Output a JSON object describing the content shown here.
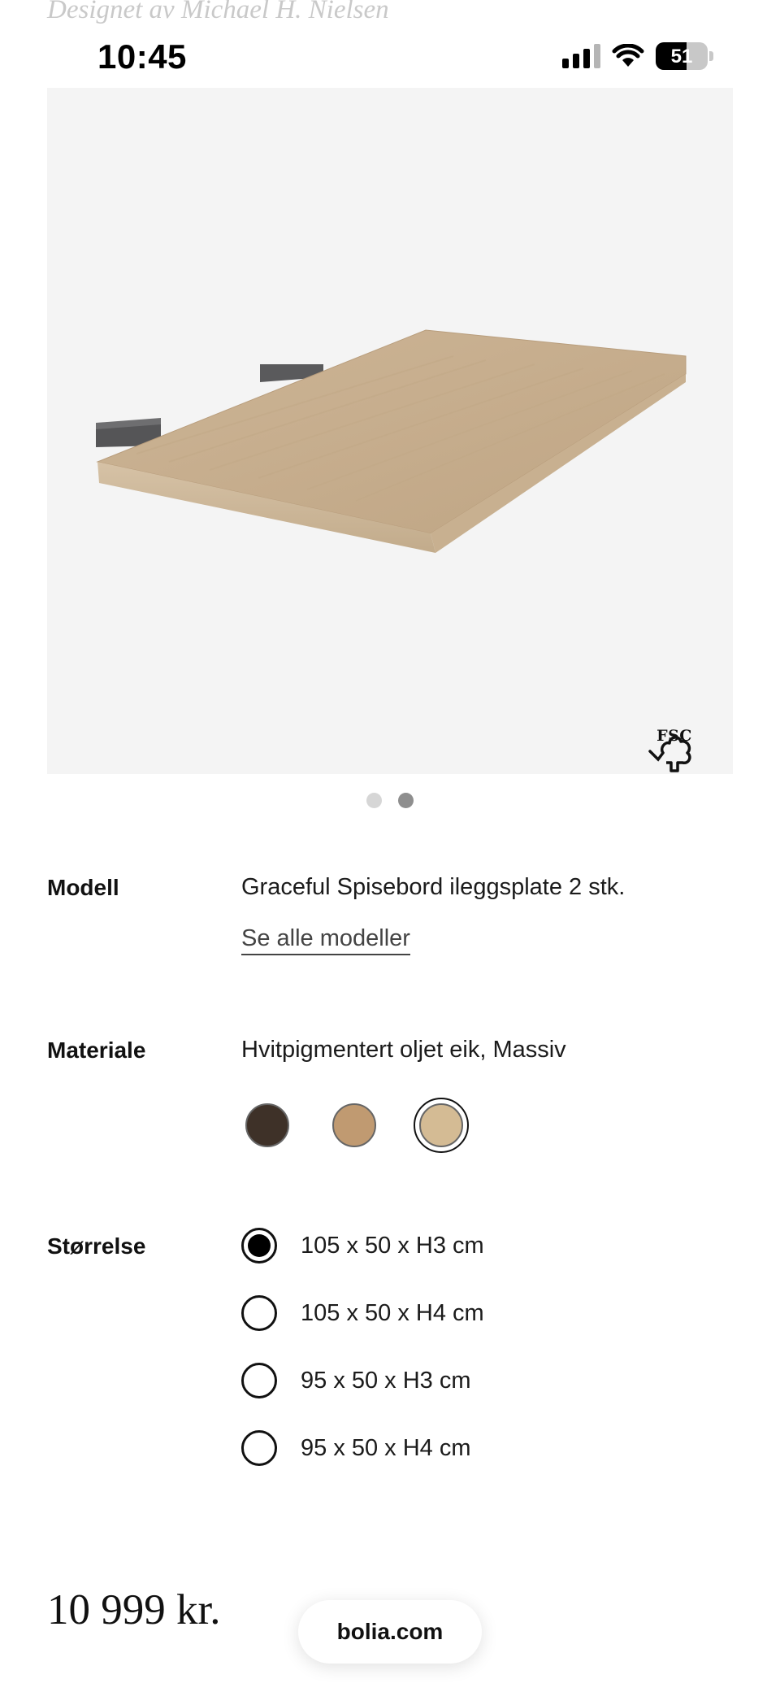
{
  "header": {
    "designer": "Designet av Michael H. Nielsen"
  },
  "status_bar": {
    "time": "10:45",
    "battery": "51"
  },
  "gallery": {
    "image": "table-extension-leaf-image",
    "badge_text": "FSC",
    "pages": 2,
    "active_page": 2
  },
  "model": {
    "label": "Modell",
    "value": "Graceful Spisebord ileggsplate 2 stk.",
    "link": "Se alle modeller"
  },
  "material": {
    "label": "Materiale",
    "value": "Hvitpigmentert oljet eik, Massiv",
    "swatches": [
      {
        "name": "dark-oak",
        "color": "#3e3128",
        "selected": false
      },
      {
        "name": "oiled-oak",
        "color": "#c09a71",
        "selected": false
      },
      {
        "name": "white-pigmented-oak",
        "color": "#d4bb94",
        "selected": true
      }
    ]
  },
  "size": {
    "label": "Størrelse",
    "options": [
      {
        "label": "105 x 50 x H3 cm",
        "selected": true
      },
      {
        "label": "105 x 50 x H4 cm",
        "selected": false
      },
      {
        "label": "95 x 50 x H3 cm",
        "selected": false
      },
      {
        "label": "95 x 50 x H4 cm",
        "selected": false
      }
    ]
  },
  "footer": {
    "price": "10 999 kr.",
    "url": "bolia.com"
  }
}
